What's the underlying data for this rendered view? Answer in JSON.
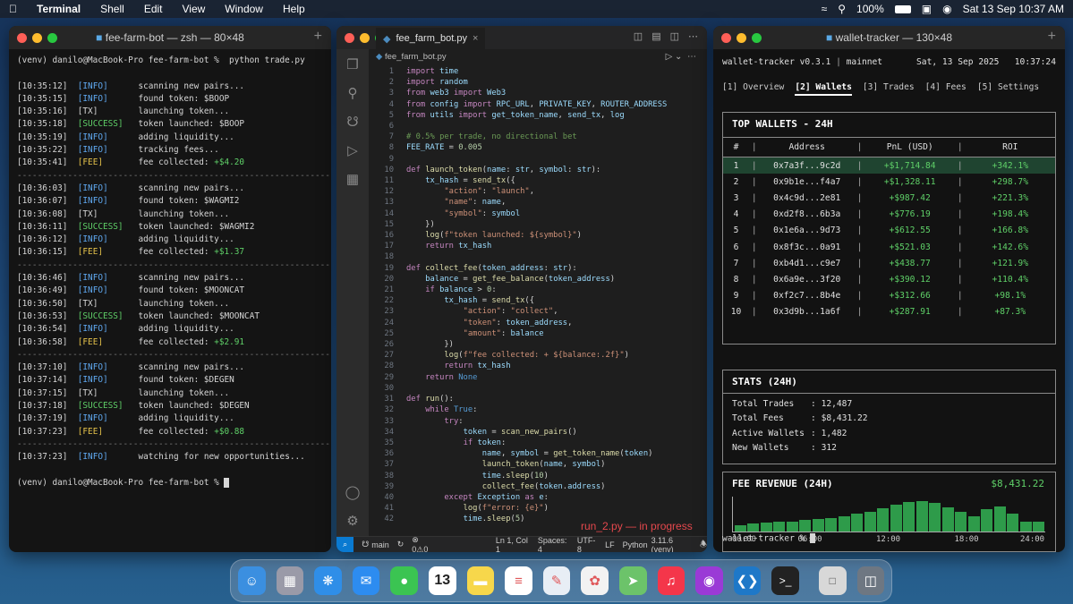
{
  "menubar": {
    "apple": "",
    "app": "Terminal",
    "items": [
      "Shell",
      "Edit",
      "View",
      "Window",
      "Help"
    ],
    "battery": "100%",
    "datetime": "Sat 13 Sep  10:37 AM"
  },
  "term1": {
    "title": "fee-farm-bot — zsh — 80×48",
    "command": "(venv) danilo@MacBook-Pro fee-farm-bot %  python trade.py",
    "separator": "--------------------------------------------------------------",
    "blocks": [
      [
        [
          "[10:35:12]",
          "INFO",
          "scanning new pairs...",
          ""
        ],
        [
          "[10:35:15]",
          "INFO",
          "found token: $BOOP",
          ""
        ],
        [
          "[10:35:16]",
          "TX",
          "launching token...",
          ""
        ],
        [
          "[10:35:18]",
          "SUCCESS",
          "token launched: $BOOP",
          ""
        ],
        [
          "[10:35:19]",
          "INFO",
          "adding liquidity...",
          ""
        ],
        [
          "[10:35:22]",
          "INFO",
          "tracking fees...",
          ""
        ],
        [
          "[10:35:41]",
          "FEE",
          "fee collected: ",
          "+$4.20"
        ]
      ],
      [
        [
          "[10:36:03]",
          "INFO",
          "scanning new pairs...",
          ""
        ],
        [
          "[10:36:07]",
          "INFO",
          "found token: $WAGMI2",
          ""
        ],
        [
          "[10:36:08]",
          "TX",
          "launching token...",
          ""
        ],
        [
          "[10:36:11]",
          "SUCCESS",
          "token launched: $WAGMI2",
          ""
        ],
        [
          "[10:36:12]",
          "INFO",
          "adding liquidity...",
          ""
        ],
        [
          "[10:36:15]",
          "FEE",
          "fee collected: ",
          "+$1.37"
        ]
      ],
      [
        [
          "[10:36:46]",
          "INFO",
          "scanning new pairs...",
          ""
        ],
        [
          "[10:36:49]",
          "INFO",
          "found token: $MOONCAT",
          ""
        ],
        [
          "[10:36:50]",
          "TX",
          "launching token...",
          ""
        ],
        [
          "[10:36:53]",
          "SUCCESS",
          "token launched: $MOONCAT",
          ""
        ],
        [
          "[10:36:54]",
          "INFO",
          "adding liquidity...",
          ""
        ],
        [
          "[10:36:58]",
          "FEE",
          "fee collected: ",
          "+$2.91"
        ]
      ],
      [
        [
          "[10:37:10]",
          "INFO",
          "scanning new pairs...",
          ""
        ],
        [
          "[10:37:14]",
          "INFO",
          "found token: $DEGEN",
          ""
        ],
        [
          "[10:37:15]",
          "TX",
          "launching token...",
          ""
        ],
        [
          "[10:37:18]",
          "SUCCESS",
          "token launched: $DEGEN",
          ""
        ],
        [
          "[10:37:19]",
          "INFO",
          "adding liquidity...",
          ""
        ],
        [
          "[10:37:23]",
          "FEE",
          "fee collected: ",
          "+$0.88"
        ]
      ],
      [
        [
          "[10:37:23]",
          "INFO",
          "watching for new opportunities...",
          ""
        ]
      ]
    ],
    "prompt": "(venv) danilo@MacBook-Pro fee-farm-bot % "
  },
  "vscode": {
    "tab": "fee_farm_bot.py",
    "breadcrumb": "fee_farm_bot.py",
    "overlay": "run_2.py — in progress",
    "status": {
      "branch": "main",
      "problems": "0⚠0",
      "position": "Ln 1, Col 1",
      "spaces": "Spaces: 4",
      "encoding": "UTF-8",
      "eol": "LF",
      "language": "Python",
      "version": "3.11.6 (venv)"
    },
    "code": [
      "import time",
      "import random",
      "from web3 import Web3",
      "from config import RPC_URL, PRIVATE_KEY, ROUTER_ADDRESS",
      "from utils import get_token_name, send_tx, log",
      "",
      "# 0.5% per trade, no directional bet",
      "FEE_RATE = 0.005",
      "",
      "def launch_token(name: str, symbol: str):",
      "    tx_hash = send_tx({",
      "        \"action\": \"launch\",",
      "        \"name\": name,",
      "        \"symbol\": symbol",
      "    })",
      "    log(f\"token launched: ${symbol}\")",
      "    return tx_hash",
      "",
      "def collect_fee(token_address: str):",
      "    balance = get_fee_balance(token_address)",
      "    if balance > 0:",
      "        tx_hash = send_tx({",
      "            \"action\": \"collect\",",
      "            \"token\": token_address,",
      "            \"amount\": balance",
      "        })",
      "        log(f\"fee collected: + ${balance:.2f}\")",
      "        return tx_hash",
      "    return None",
      "",
      "def run():",
      "    while True:",
      "        try:",
      "            token = scan_new_pairs()",
      "            if token:",
      "                name, symbol = get_token_name(token)",
      "                launch_token(name, symbol)",
      "                time.sleep(10)",
      "                collect_fee(token.address)",
      "        except Exception as e:",
      "            log(f\"error: {e}\")",
      "            time.sleep(5)"
    ]
  },
  "tracker": {
    "title": "wallet-tracker — 130×48",
    "app": "wallet-tracker v0.3.1",
    "network": "mainnet",
    "date": "Sat, 13 Sep 2025",
    "time": "10:37:24",
    "tabs": [
      "[1] Overview",
      "[2] Wallets",
      "[3] Trades",
      "[4] Fees",
      "[5] Settings"
    ],
    "active_tab": 1,
    "wallets_title": "TOP WALLETS - 24H",
    "columns": [
      "#",
      "Address",
      "PnL (USD)",
      "ROI"
    ],
    "wallets": [
      [
        "1",
        "0x7a3f...9c2d",
        "+$1,714.84",
        "+342.1%"
      ],
      [
        "2",
        "0x9b1e...f4a7",
        "+$1,328.11",
        "+298.7%"
      ],
      [
        "3",
        "0x4c9d...2e81",
        "+$987.42",
        "+221.3%"
      ],
      [
        "4",
        "0xd2f8...6b3a",
        "+$776.19",
        "+198.4%"
      ],
      [
        "5",
        "0x1e6a...9d73",
        "+$612.55",
        "+166.8%"
      ],
      [
        "6",
        "0x8f3c...0a91",
        "+$521.03",
        "+142.6%"
      ],
      [
        "7",
        "0xb4d1...c9e7",
        "+$438.77",
        "+121.9%"
      ],
      [
        "8",
        "0x6a9e...3f20",
        "+$390.12",
        "+110.4%"
      ],
      [
        "9",
        "0xf2c7...8b4e",
        "+$312.66",
        "+98.1%"
      ],
      [
        "10",
        "0x3d9b...1a6f",
        "+$287.91",
        "+87.3%"
      ]
    ],
    "stats_title": "STATS (24H)",
    "stats": [
      [
        "Total Trades",
        "12,487"
      ],
      [
        "Total Fees",
        "$8,431.22"
      ],
      [
        "Active Wallets",
        "1,482"
      ],
      [
        "New Wallets",
        "312"
      ]
    ],
    "revenue_title": "FEE REVENUE (24H)",
    "revenue_total": "$8,431.22",
    "prompt": "wallet-tracker % ",
    "accent": "#5fd068"
  },
  "chart_data": {
    "type": "bar",
    "title": "FEE REVENUE (24H)",
    "x_ticks": [
      "00:00",
      "06:00",
      "12:00",
      "18:00",
      "24:00"
    ],
    "values": [
      0.18,
      0.24,
      0.26,
      0.28,
      0.3,
      0.33,
      0.36,
      0.4,
      0.46,
      0.52,
      0.58,
      0.68,
      0.78,
      0.86,
      0.9,
      0.84,
      0.72,
      0.58,
      0.46,
      0.66,
      0.74,
      0.52,
      0.3,
      0.28
    ],
    "ylim": [
      0,
      1
    ]
  },
  "dock": [
    "finder-icon",
    "launchpad-icon",
    "safari-icon",
    "mail-icon",
    "messages-icon",
    "calendar-icon",
    "notes-icon",
    "reminders-icon",
    "freeform-icon",
    "photos-icon",
    "maps-icon",
    "music-icon",
    "podcasts-icon",
    "vscode-icon",
    "terminal-icon",
    "document-icon",
    "trash-icon"
  ],
  "dock_calendar_day": "13"
}
